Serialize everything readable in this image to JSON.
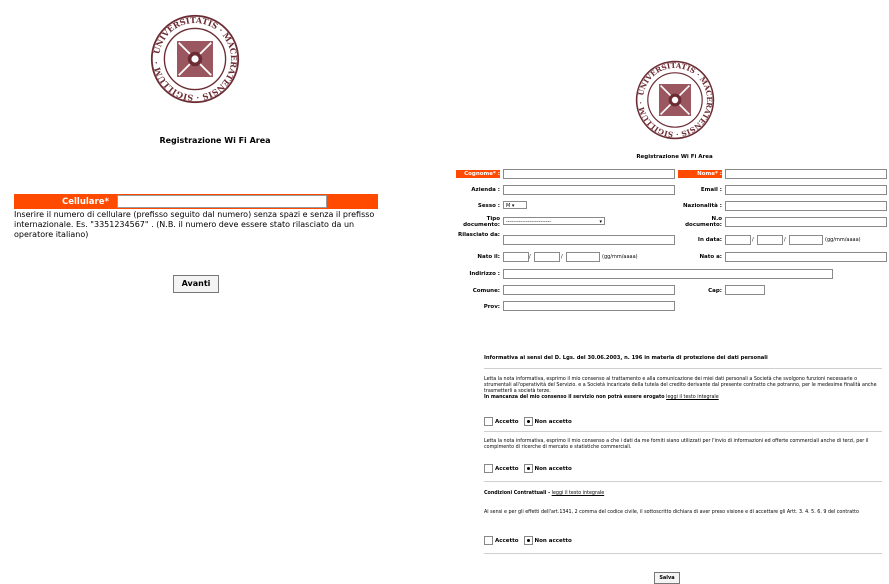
{
  "left": {
    "title": "Registrazione Wi Fi Area",
    "phone_label": "Cellulare*",
    "phone_value": "",
    "help_text": "Inserire il numero di cellulare (prefisso seguito dal numero) senza spazi e senza il prefisso internazionale. Es. \"3351234567\" . (N.B. il numero deve essere stato rilasciato da un operatore italiano)",
    "submit_label": "Avanti"
  },
  "right": {
    "title": "Registrazione Wi Fi Area",
    "labels": {
      "cognome": "Cognome* :",
      "nome": "Nome* :",
      "azienda": "Azienda :",
      "email": "Email :",
      "sesso": "Sesso :",
      "nazionalita": "Nazionalità :",
      "tipo_documento": "Tipo documento:",
      "n_documento": "N.o documento:",
      "rilasciato_da": "Rilasciato da:",
      "in_data": "In data:",
      "nato_il": "Nato il:",
      "nato_a": "Nato a:",
      "indirizzo": "Indirizzo :",
      "comune": "Comune:",
      "cap": "Cap:",
      "prov": "Prov:"
    },
    "sesso_value": "M",
    "tipo_documento_value": "-------------------------",
    "date_format": "(gg/mm/aaaa)",
    "date_sep": "/",
    "informativa_title": "Informativa ai sensi del D. Lgs. del 30.06.2003, n. 196 in materia di protezione dei dati personali",
    "consent1_text": "Letta la nota informativa, esprimo il mio consenso al trattamento e alla comunicazione dei miei dati personali a Società che svolgono funzioni necessarie o strumentali all'operatività del Servizio. e a Società incaricate della tutela del credito derivante dal presente contratto che potranno, per le medesime finalità anche trasmetterli a società terze.",
    "consent1_bold": "In mancanza del mio consenso il servizio non potrà essere erogato",
    "read_full_link": "leggi il testo integrale",
    "consent2_text": "Letta la nota informativa, esprimo il mio consenso a che i dati da me forniti siano utilizzati per l'invio di informazioni ed offerte commerciali anche di terzi, per il compimento di ricerche di mercato e statistiche commerciali.",
    "conditions_title": "Condizioni Contrattuali -",
    "conditions_text": "Ai sensi e per gli effetti dell'art.1341, 2 comma del codice civile, il sottoscritto dichiara di aver preso visione e di accettare gli Artt. 3. 4. 5. 6. 9 del contratto",
    "accept_label": "Accetto",
    "reject_label": "Non accetto",
    "save_label": "Salva"
  },
  "seal_text": "UNIVERSITATIS MACERATENSIS SIGILLUM",
  "colors": {
    "highlight": "#ff4a00",
    "seal": "#6b2c34"
  }
}
